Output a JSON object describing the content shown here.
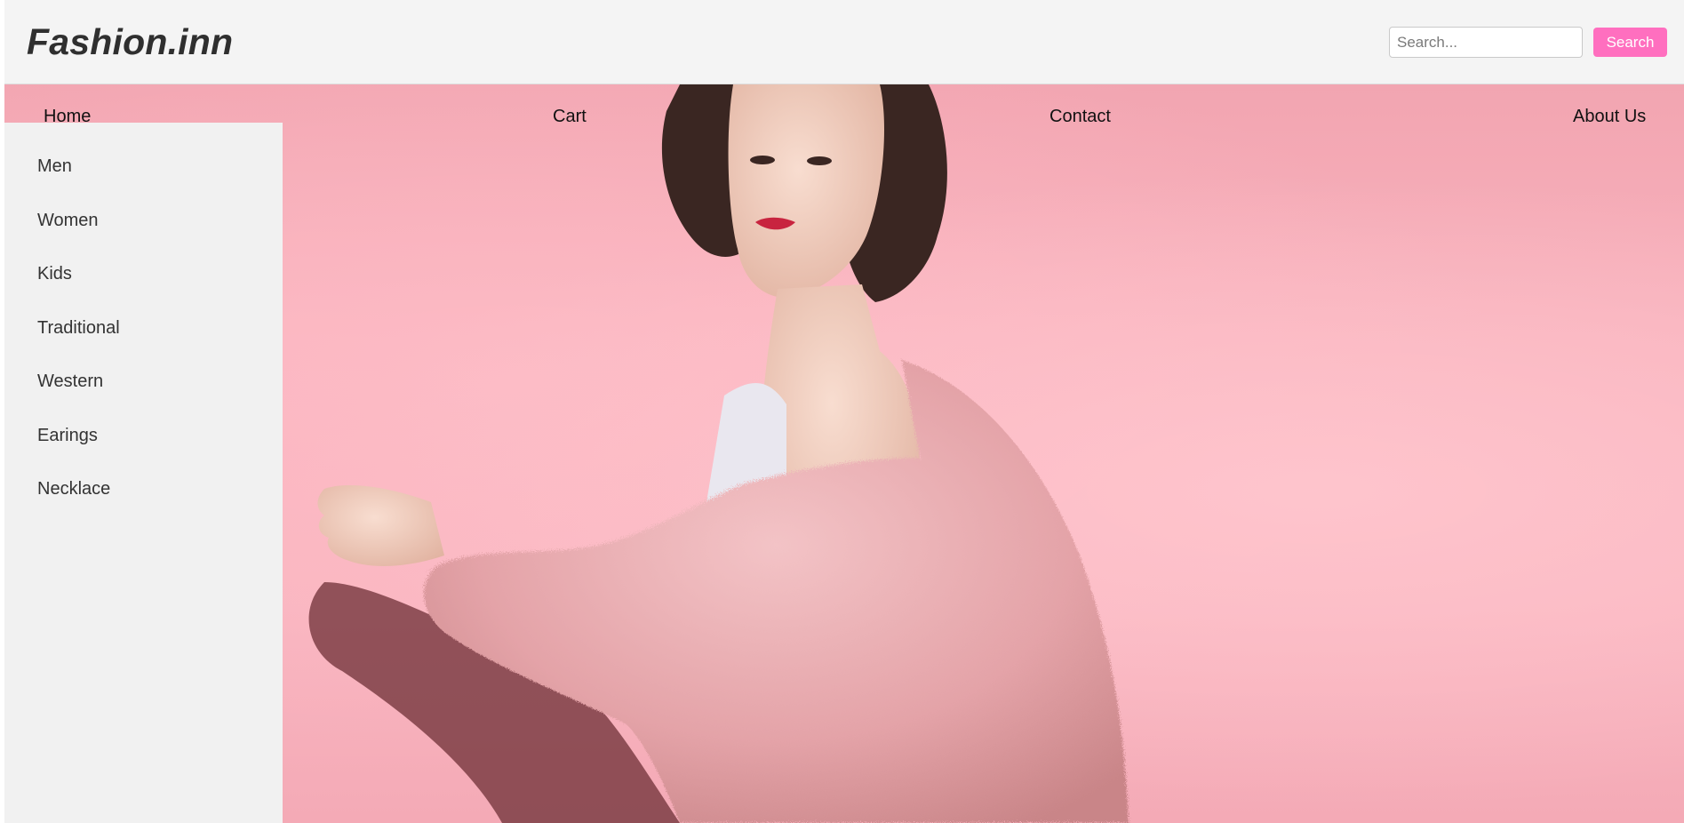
{
  "header": {
    "logo": "Fashion.inn",
    "search": {
      "placeholder": "Search...",
      "value": "",
      "button_label": "Search"
    }
  },
  "nav": {
    "items": [
      {
        "label": "Home"
      },
      {
        "label": "Cart"
      },
      {
        "label": "Contact"
      },
      {
        "label": "About Us"
      }
    ]
  },
  "sidebar": {
    "items": [
      {
        "label": "Men"
      },
      {
        "label": "Women"
      },
      {
        "label": "Kids"
      },
      {
        "label": "Traditional"
      },
      {
        "label": "Western"
      },
      {
        "label": "Earings"
      },
      {
        "label": "Necklace"
      }
    ]
  },
  "colors": {
    "accent": "#ff6fbf",
    "hero_background": "#f8b2bd",
    "header_background": "#f4f4f4",
    "sidebar_background": "#f1f1f1"
  },
  "hero": {
    "image": "woman-in-pink-fur-coat"
  }
}
